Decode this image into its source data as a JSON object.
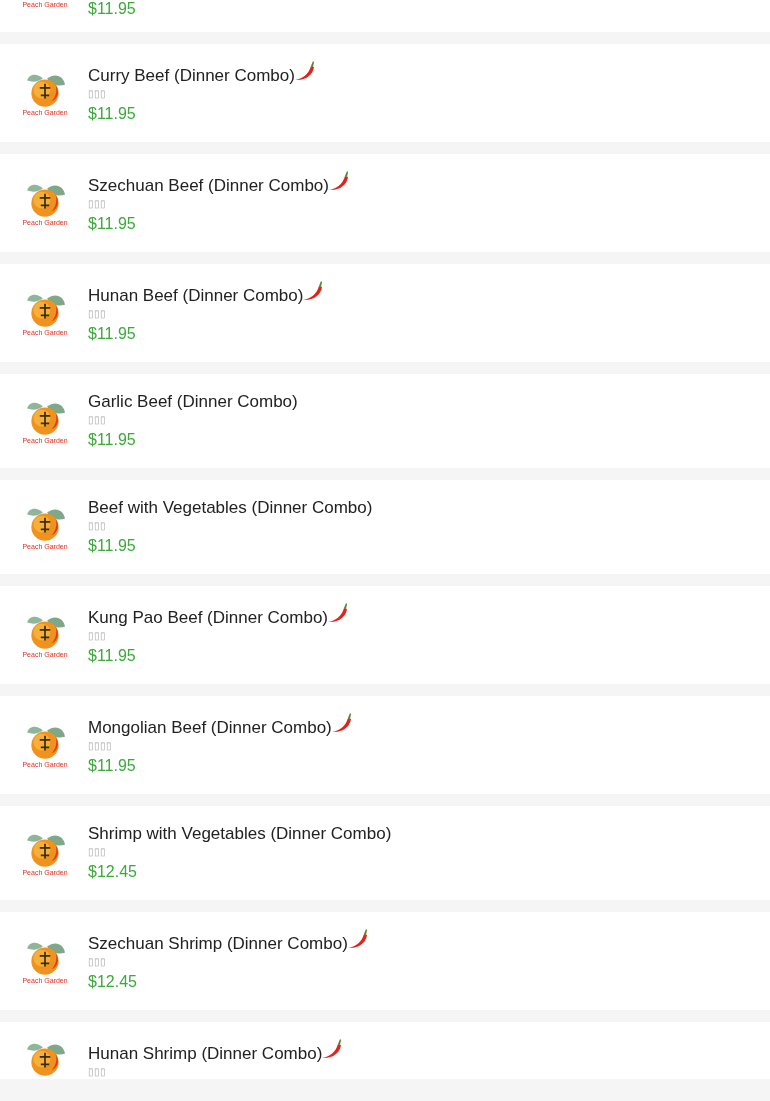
{
  "items": [
    {
      "kind": "partial",
      "logo_text": "Peach Garden",
      "price": "$11.95"
    },
    {
      "kind": "full",
      "logo_text": "Peach Garden",
      "title": "Curry Beef (Dinner Combo)",
      "spicy": true,
      "subtitle": "▯▯▯",
      "price": "$11.95"
    },
    {
      "kind": "full",
      "logo_text": "Peach Garden",
      "title": "Szechuan Beef (Dinner Combo)",
      "spicy": true,
      "subtitle": "▯▯▯",
      "price": "$11.95"
    },
    {
      "kind": "full",
      "logo_text": "Peach Garden",
      "title": "Hunan Beef (Dinner Combo)",
      "spicy": true,
      "subtitle": "▯▯▯",
      "price": "$11.95"
    },
    {
      "kind": "full",
      "logo_text": "Peach Garden",
      "title": "Garlic Beef (Dinner Combo)",
      "spicy": false,
      "subtitle": "▯▯▯",
      "price": "$11.95"
    },
    {
      "kind": "full",
      "logo_text": "Peach Garden",
      "title": "Beef with Vegetables (Dinner Combo)",
      "spicy": false,
      "subtitle": "▯▯▯",
      "price": "$11.95"
    },
    {
      "kind": "full",
      "logo_text": "Peach Garden",
      "title": "Kung Pao Beef (Dinner Combo)",
      "spicy": true,
      "subtitle": "▯▯▯",
      "price": "$11.95"
    },
    {
      "kind": "full",
      "logo_text": "Peach Garden",
      "title": "Mongolian Beef (Dinner Combo)",
      "spicy": true,
      "subtitle": "▯▯▯▯",
      "price": "$11.95"
    },
    {
      "kind": "full",
      "logo_text": "Peach Garden",
      "title": "Shrimp with Vegetables (Dinner Combo)",
      "spicy": false,
      "subtitle": "▯▯▯",
      "price": "$12.45"
    },
    {
      "kind": "full",
      "logo_text": "Peach Garden",
      "title": "Szechuan Shrimp (Dinner Combo)",
      "spicy": true,
      "subtitle": "▯▯▯",
      "price": "$12.45"
    },
    {
      "kind": "full",
      "title": "Hunan Shrimp (Dinner Combo)",
      "spicy": true,
      "subtitle": "▯▯▯"
    }
  ]
}
